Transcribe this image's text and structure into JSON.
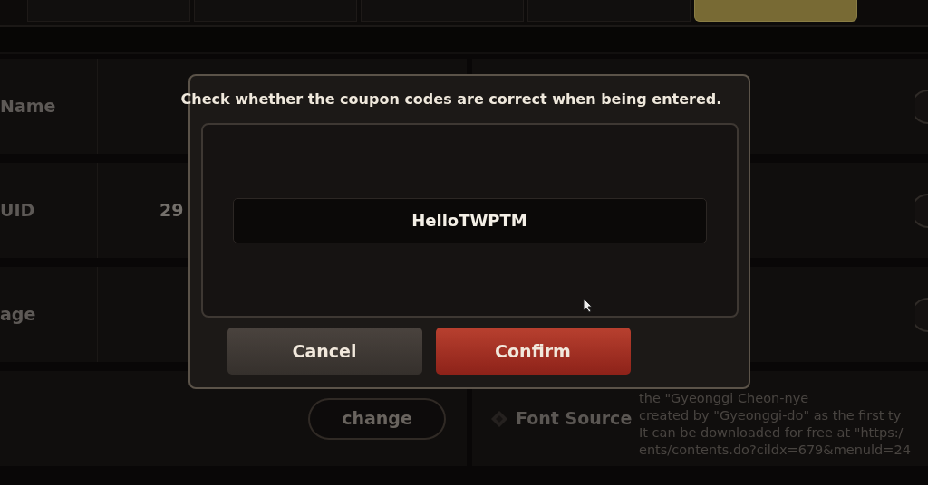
{
  "tabs": [
    {
      "selected": false
    },
    {
      "selected": false
    },
    {
      "selected": false
    },
    {
      "selected": false
    },
    {
      "selected": true
    }
  ],
  "account_rows": [
    {
      "label": "Name"
    },
    {
      "label": "UID",
      "value": "29"
    },
    {
      "label": "age"
    },
    {
      "button": "change"
    }
  ],
  "font_source": {
    "label": "Font Source",
    "lines": [
      "the \"Gyeonggi Cheon-nye",
      "created by \"Gyeonggi-do\" as the first ty",
      "It can be downloaded for free at \"https:/",
      "ents/contents.do?cildx=679&menuld=24"
    ]
  },
  "dialog": {
    "message": "Check whether the coupon codes are correct when being entered.",
    "code": "HelloTWPTM",
    "buttons": [
      {
        "label": "Cancel",
        "kind": "secondary"
      },
      {
        "label": "Confirm",
        "kind": "primary"
      }
    ]
  }
}
